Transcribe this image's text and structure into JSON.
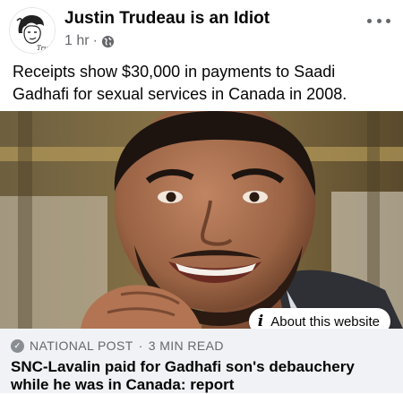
{
  "post": {
    "page_name": "Justin Trudeau is an Idiot",
    "timestamp": "1 hr",
    "separator": "·",
    "privacy_icon": "globe-icon",
    "more_icon": "more-options-icon",
    "text": "Receipts show $30,000 in payments to Saadi Gadhafi for sexual services in Canada in 2008.",
    "avatar_caption": "Trudo"
  },
  "link_preview": {
    "about_label": "About this website",
    "about_icon": "info-icon",
    "source": "NATIONAL POST",
    "read_time": "3 MIN READ",
    "source_separator": "·",
    "title": "SNC-Lavalin paid for Gadhafi son's debauchery while he was in Canada: report"
  }
}
